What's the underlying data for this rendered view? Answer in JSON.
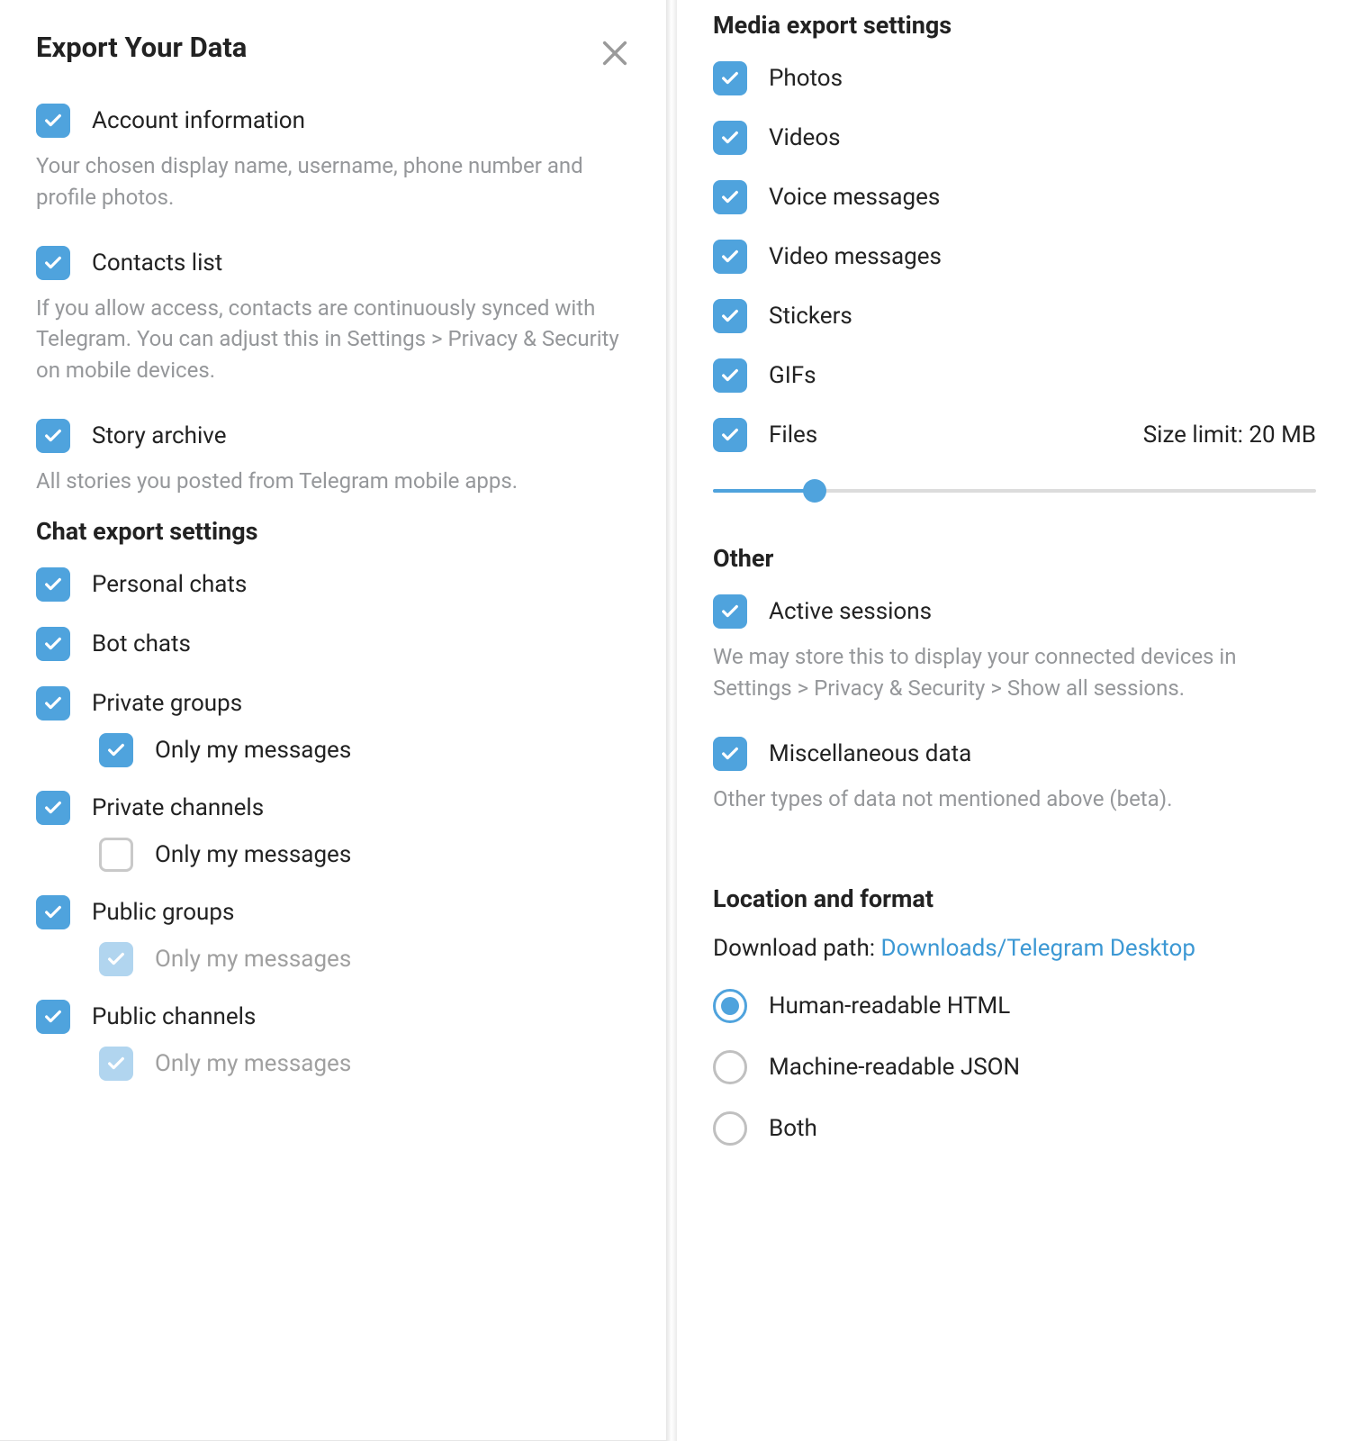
{
  "title": "Export Your Data",
  "left": {
    "account_info": {
      "label": "Account information",
      "desc": "Your chosen display name, username, phone number and profile photos.",
      "checked": true
    },
    "contacts": {
      "label": "Contacts list",
      "desc": "If you allow access, contacts are continuously synced with Telegram. You can adjust this in Settings > Privacy & Security on mobile devices.",
      "checked": true
    },
    "story": {
      "label": "Story archive",
      "desc": "All stories you posted from Telegram mobile apps.",
      "checked": true
    },
    "chat_section": "Chat export settings",
    "chats": {
      "personal": {
        "label": "Personal chats",
        "checked": true
      },
      "bot": {
        "label": "Bot chats",
        "checked": true
      },
      "private_groups": {
        "label": "Private groups",
        "checked": true,
        "only_label": "Only my messages",
        "only_checked": true,
        "only_disabled": false
      },
      "private_channels": {
        "label": "Private channels",
        "checked": true,
        "only_label": "Only my messages",
        "only_checked": false,
        "only_disabled": false
      },
      "public_groups": {
        "label": "Public groups",
        "checked": true,
        "only_label": "Only my messages",
        "only_checked": true,
        "only_disabled": true
      },
      "public_channels": {
        "label": "Public channels",
        "checked": true,
        "only_label": "Only my messages",
        "only_checked": true,
        "only_disabled": true
      }
    }
  },
  "right": {
    "media_section": "Media export settings",
    "media": {
      "photos": {
        "label": "Photos",
        "checked": true
      },
      "videos": {
        "label": "Videos",
        "checked": true
      },
      "voice": {
        "label": "Voice messages",
        "checked": true
      },
      "video_msgs": {
        "label": "Video messages",
        "checked": true
      },
      "stickers": {
        "label": "Stickers",
        "checked": true
      },
      "gifs": {
        "label": "GIFs",
        "checked": true
      },
      "files": {
        "label": "Files",
        "checked": true,
        "size_limit": "Size limit: 20 MB"
      }
    },
    "other_section": "Other",
    "other": {
      "sessions": {
        "label": "Active sessions",
        "desc": "We may store this to display your connected devices in Settings > Privacy & Security > Show all sessions.",
        "checked": true
      },
      "misc": {
        "label": "Miscellaneous data",
        "desc": "Other types of data not mentioned above (beta).",
        "checked": true
      }
    },
    "format_section": "Location and format",
    "download_path_label": "Download path: ",
    "download_path_value": "Downloads/Telegram Desktop",
    "formats": {
      "html": {
        "label": "Human-readable HTML",
        "selected": true
      },
      "json": {
        "label": "Machine-readable JSON",
        "selected": false
      },
      "both": {
        "label": "Both",
        "selected": false
      }
    }
  }
}
